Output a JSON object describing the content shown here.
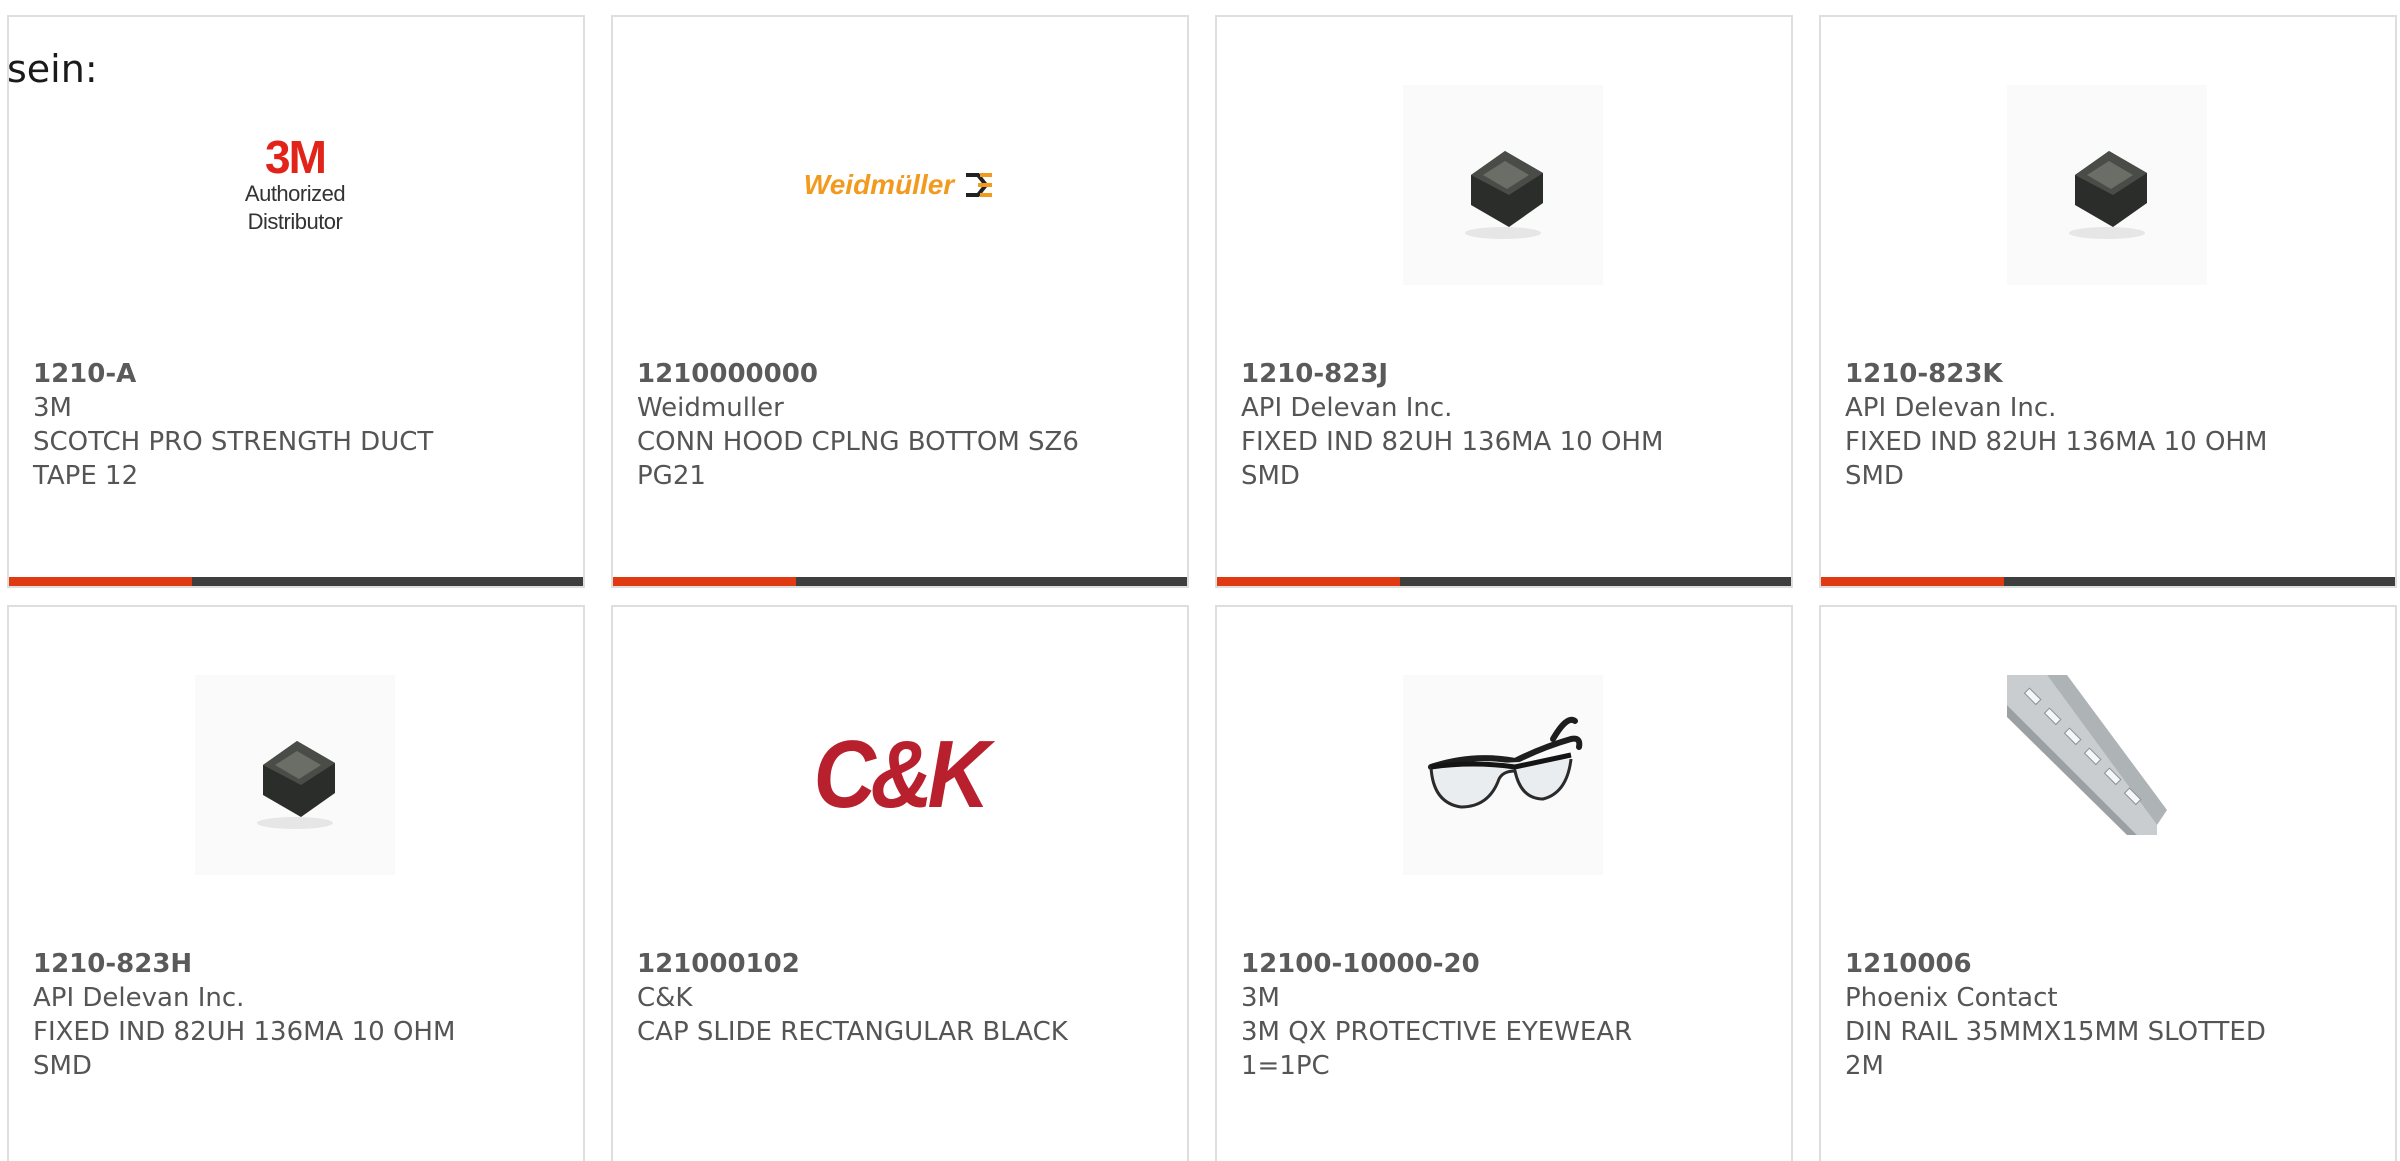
{
  "page_label": "sein:",
  "colors": {
    "accent": "#e03a12",
    "bar_dark": "#3e3e3e",
    "card_border": "#dedede",
    "text": "#555555"
  },
  "products": [
    {
      "part_number": "1210-A",
      "manufacturer": "3M",
      "description": "SCOTCH PRO STRENGTH DUCT TAPE 12",
      "image": "3m-authorized-distributor-logo",
      "logo_text": {
        "brand": "3M",
        "tagline": "Authorized Distributor"
      },
      "has_progress_bar": true
    },
    {
      "part_number": "1210000000",
      "manufacturer": "Weidmuller",
      "description": "CONN HOOD CPLNG BOTTOM SZ6 PG21",
      "image": "weidmuller-logo",
      "logo_text": {
        "brand": "Weidmüller"
      },
      "has_progress_bar": true
    },
    {
      "part_number": "1210-823J",
      "manufacturer": "API Delevan Inc.",
      "description": "FIXED IND 82UH 136MA 10 OHM SMD",
      "image": "smd-inductor-photo",
      "has_progress_bar": true
    },
    {
      "part_number": "1210-823K",
      "manufacturer": "API Delevan Inc.",
      "description": "FIXED IND 82UH 136MA 10 OHM SMD",
      "image": "smd-inductor-photo",
      "has_progress_bar": true
    },
    {
      "part_number": "1210-823H",
      "manufacturer": "API Delevan Inc.",
      "description": "FIXED IND 82UH 136MA 10 OHM SMD",
      "image": "smd-inductor-photo",
      "has_progress_bar": false
    },
    {
      "part_number": "121000102",
      "manufacturer": "C&K",
      "description": "CAP SLIDE RECTANGULAR BLACK",
      "image": "ck-logo",
      "logo_text": {
        "brand": "C&K"
      },
      "has_progress_bar": false
    },
    {
      "part_number": "12100-10000-20",
      "manufacturer": "3M",
      "description": "3M QX PROTECTIVE EYEWEAR 1=1PC",
      "image": "protective-eyewear-photo",
      "has_progress_bar": false
    },
    {
      "part_number": "1210006",
      "manufacturer": "Phoenix Contact",
      "description": "DIN RAIL 35MMX15MM SLOTTED 2M",
      "image": "din-rail-photo",
      "has_progress_bar": false
    }
  ]
}
